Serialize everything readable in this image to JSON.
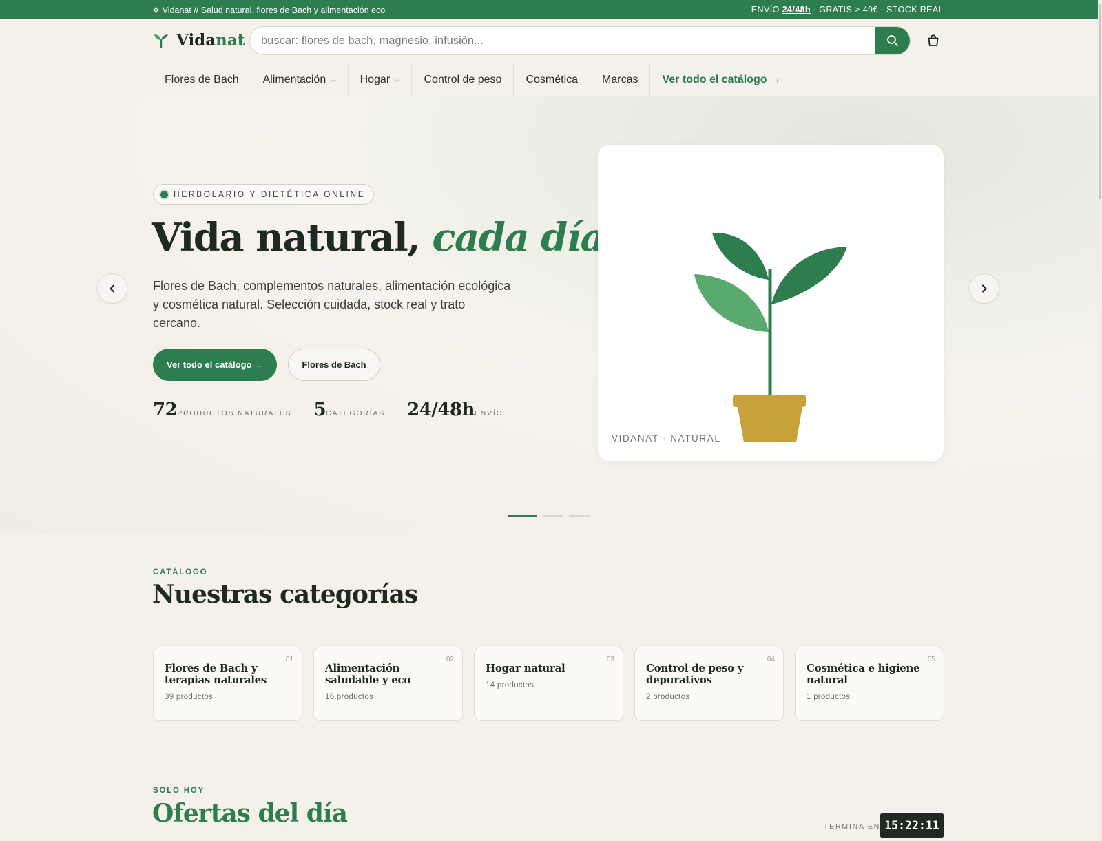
{
  "topbar": {
    "left_text": "❖ Vidanat // Salud natural, flores de Bach y alimentación eco",
    "right_prefix": "ENVÍO ",
    "right_highlight": "24/48h",
    "right_suffix": " · GRATIS > 49€ · STOCK REAL"
  },
  "header": {
    "logo_main": "Vida",
    "logo_accent": "nat",
    "search_placeholder": "buscar: flores de bach, magnesio, infusión...",
    "search_value": "",
    "search_icon": "search-icon",
    "cart_icon": "shopping-bag-icon"
  },
  "nav": {
    "items": [
      {
        "label": "Flores de Bach",
        "has_dropdown": false
      },
      {
        "label": "Alimentación",
        "has_dropdown": true
      },
      {
        "label": "Hogar",
        "has_dropdown": true
      },
      {
        "label": "Control de peso",
        "has_dropdown": false
      },
      {
        "label": "Cosmética",
        "has_dropdown": false
      },
      {
        "label": "Marcas",
        "has_dropdown": false
      },
      {
        "label": "Ver todo el catálogo →",
        "has_dropdown": false
      }
    ],
    "dropdown_glyph": "⌵"
  },
  "hero": {
    "badge": "HERBOLARIO Y DIETÉTICA ONLINE",
    "title_main": "Vida natural, ",
    "title_accent": "cada día",
    "lead": "Flores de Bach, complementos naturales, alimentación ecológica y cosmética natural. Selección cuidada, stock real y trato cercano.",
    "primary_cta": "Ver todo el catálogo →",
    "secondary_cta": "Flores de Bach",
    "stats": [
      {
        "value": "72",
        "label": "PRODUCTOS NATURALES"
      },
      {
        "value": "5",
        "label": "CATEGORÍAS"
      },
      {
        "value": "24/48h",
        "label": "ENVÍO"
      }
    ],
    "card_caption": "VIDANAT · NATURAL",
    "slides_total": 3,
    "active_slide": 1
  },
  "categories": {
    "eyebrow": "CATÁLOGO",
    "title": "Nuestras categorías",
    "items": [
      {
        "num": "01",
        "name": "Flores de Bach y terapias naturales",
        "count": "39 productos"
      },
      {
        "num": "02",
        "name": "Alimentación saludable y eco",
        "count": "16 productos"
      },
      {
        "num": "03",
        "name": "Hogar natural",
        "count": "14 productos"
      },
      {
        "num": "04",
        "name": "Control de peso y depurativos",
        "count": "2 productos"
      },
      {
        "num": "05",
        "name": "Cosmética e higiene natural",
        "count": "1 productos"
      }
    ]
  },
  "offers": {
    "eyebrow": "SOLO HOY",
    "title": "Ofertas del día",
    "timer_label": "TERMINA EN",
    "timer_value": "15:22:11"
  },
  "colors": {
    "brand_green": "#2e7d4f",
    "dark": "#1e2a20",
    "background": "#f3f1ea",
    "pot": "#c9a13a"
  }
}
